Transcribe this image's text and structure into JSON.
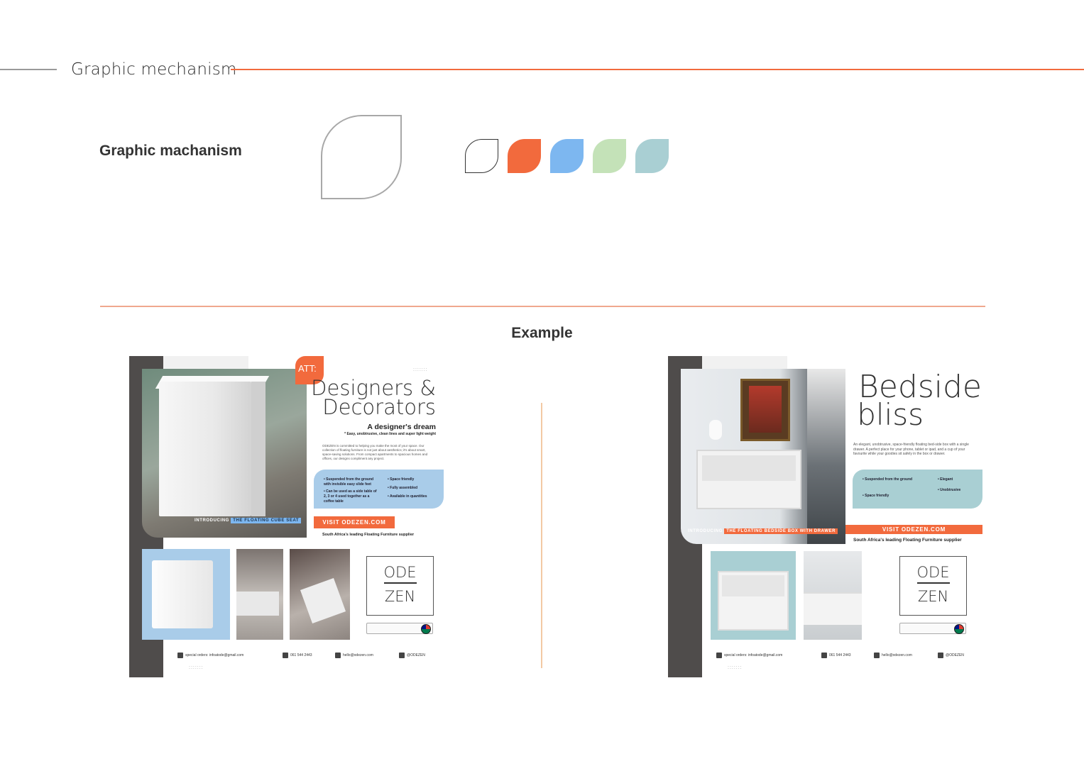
{
  "header": {
    "title": "Graphic mechanism"
  },
  "section": {
    "title": "Graphic machanism"
  },
  "swatches": [
    {
      "name": "outline",
      "color": "#ffffff"
    },
    {
      "name": "orange",
      "color": "#f26a3d"
    },
    {
      "name": "blue",
      "color": "#7db7f0"
    },
    {
      "name": "green",
      "color": "#c4e2b8"
    },
    {
      "name": "teal",
      "color": "#a9cfd3"
    }
  ],
  "example": {
    "title": "Example"
  },
  "poster1": {
    "badge": "ATT:",
    "headline1": "Designers &",
    "headline2": "Decorators",
    "tagline": "A designer's dream",
    "subline": "* Easy, unobtrusive, clean lines and super light weight",
    "body": "ODEZEN is committed to helping you make the most of your space. Our collection of floating furniture is not just about aesthetics; it's about smart, space-saving solutions. From compact apartments to spacious homes and offices, our designs compliment any project.",
    "features_left": [
      "• Suspended from the ground with invisible easy slide feet",
      "• Can be used as a side table of 2, 3 or 4 used together as a coffee table"
    ],
    "features_right": [
      "• Space friendly",
      "• Fully assembled",
      "• Available in quantities"
    ],
    "intro": "INTRODUCING",
    "product": "THE FLOATING CUBE SEAT",
    "visit": "VISIT ODEZEN.COM",
    "supplier": "South Africa's leading Floating Furniture supplier"
  },
  "poster2": {
    "headline1": "Bedside",
    "headline2": "bliss",
    "body": "An elegant, unobtrusive, space-friendly floating bed-side box with a single drawer. A perfect place for your phone, tablet or ipad, and a cup of your favourite while your goodies sit safely in the box or drawer.",
    "features_left": [
      "• Suspended from the ground",
      "• Space friendly"
    ],
    "features_right": [
      "• Elegant",
      "• Unobtrusive"
    ],
    "intro": "INTRODUCING",
    "product": "THE FLOATING BEDSIDE BOX WITH DRAWER",
    "visit": "VISIT ODEZEN.COM",
    "supplier": "South Africa's leading Floating Furniture supplier"
  },
  "logo": {
    "line1": "ODE",
    "line2": "ZEN"
  },
  "contacts": {
    "orders": "special orders: infoatode@gmail.com",
    "phone": "061 544 2443",
    "email": "hello@odezen.com",
    "social": "@ODEZEN"
  }
}
